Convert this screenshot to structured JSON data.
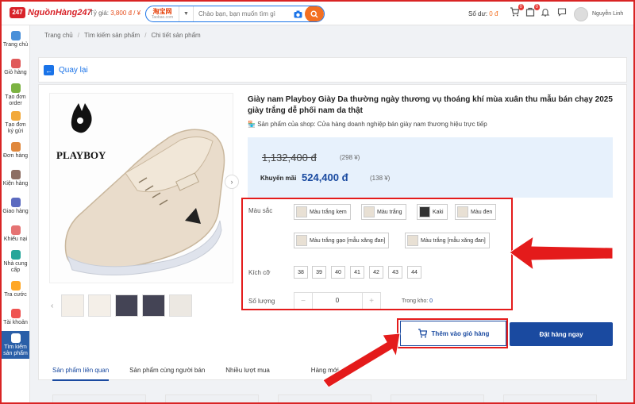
{
  "topbar": {
    "logo_text": "NguồnHàng247",
    "rate_label": "Tỷ giá:",
    "rate_value": "3,800 đ / ¥",
    "site_logo_text": "淘宝网",
    "site_logo_sub": "Taobao.com",
    "search_placeholder": "Chào bạn, bạn muốn tìm gì",
    "balance_label": "Số dư:",
    "balance_value": "0 đ",
    "cart_badge": "0",
    "order_badge": "0",
    "user_name": "Nguyễn Linh"
  },
  "sidebar": {
    "items": [
      {
        "label": "Trang chủ",
        "color": "#4a90d9"
      },
      {
        "label": "Giỏ hàng",
        "color": "#e05a5a"
      },
      {
        "label": "Tạo đơn order",
        "color": "#7cb342"
      },
      {
        "label": "Tạo đơn ký gửi",
        "color": "#f2a93b"
      },
      {
        "label": "Đơn hàng",
        "color": "#e0883d"
      },
      {
        "label": "Kiện hàng",
        "color": "#8d6e63"
      },
      {
        "label": "Giao hàng",
        "color": "#5c6bc0"
      },
      {
        "label": "Khiếu nại",
        "color": "#e57373"
      },
      {
        "label": "Nhà cung cấp",
        "color": "#26a69a"
      },
      {
        "label": "Tra cước",
        "color": "#ffa726"
      },
      {
        "label": "Tài khoản",
        "color": "#ef5350"
      },
      {
        "label": "Tìm kiếm sản phẩm",
        "color": "#ffffff"
      }
    ]
  },
  "breadcrumb": {
    "home": "Trang chủ",
    "search": "Tìm kiếm sản phẩm",
    "detail": "Chi tiết sản phẩm"
  },
  "back_label": "Quay lại",
  "product": {
    "title": "Giày nam Playboy Giày Da thường ngày thương vụ thoáng khí mùa xuân thu mẫu bán chạy 2025 giày trắng dễ phối nam da thật",
    "brand": "PLAYBOY",
    "shop": "Sản phẩm của shop: Cửa hàng doanh nghiệp bán giày nam thương hiệu trực tiếp",
    "old_price": "1,132,400 đ",
    "old_price_cny": "(298 ¥)",
    "promo_label": "Khuyến mãi",
    "price": "524,400 đ",
    "price_cny": "(138 ¥)",
    "color_label": "Màu sắc",
    "colors": [
      "Màu trắng kem",
      "Màu trắng",
      "Kaki",
      "Màu đen",
      "Màu trắng gạo [mẫu xăng đan]",
      "Màu trắng [mẫu xăng đan]"
    ],
    "size_label": "Kích cỡ",
    "sizes": [
      "38",
      "39",
      "40",
      "41",
      "42",
      "43",
      "44"
    ],
    "qty_label": "Số lượng",
    "qty_minus": "−",
    "qty_value": "0",
    "qty_plus": "+",
    "stock_label": "Trong kho:",
    "stock_value": "0",
    "add_cart": "Thêm vào giỏ hàng",
    "buy_now": "Đặt hàng ngay"
  },
  "tabs": [
    "Sản phẩm liên quan",
    "Sản phẩm cùng người bán",
    "Nhiều lượt mua",
    "Hàng mới"
  ],
  "colors": {
    "primary": "#1a4aa0",
    "accent_orange": "#f36f21",
    "highlight_red": "#e41b1b"
  }
}
